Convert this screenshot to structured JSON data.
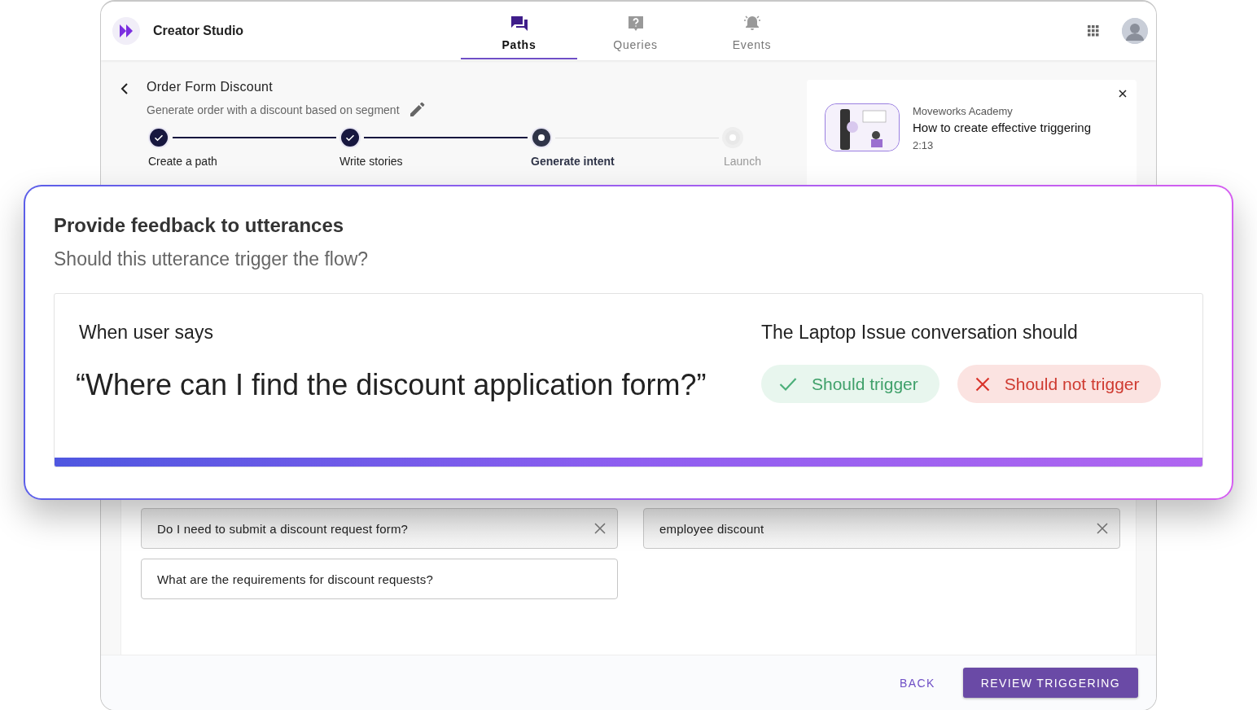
{
  "app": {
    "title": "Creator Studio"
  },
  "tabs": [
    {
      "label": "Paths",
      "selected": true
    },
    {
      "label": "Queries",
      "selected": false
    },
    {
      "label": "Events",
      "selected": false
    }
  ],
  "path": {
    "title": "Order Form Discount",
    "description": "Generate order with a discount based on segment"
  },
  "steps": [
    {
      "label": "Create a path",
      "kind": "done"
    },
    {
      "label": "Write stories",
      "kind": "done"
    },
    {
      "label": "Generate intent",
      "kind": "current"
    },
    {
      "label": "Launch",
      "kind": "pending"
    }
  ],
  "academy": {
    "source": "Moveworks Academy",
    "title": "How to create effective triggering",
    "duration": "2:13"
  },
  "utterances": [
    {
      "text": "Do I need to submit a discount request form?",
      "removable": true
    },
    {
      "text": "employee discount",
      "removable": true
    },
    {
      "text": "What are the requirements for discount requests?",
      "removable": false
    }
  ],
  "footer": {
    "buttons": [
      {
        "label": "BACK",
        "kind": "text"
      },
      {
        "label": "REVIEW TRIGGERING",
        "kind": "primary"
      }
    ]
  },
  "feedback": {
    "title": "Provide feedback to utterances",
    "subtitle": "Should this utterance trigger the flow?",
    "left_label": "When user says",
    "utterance": "“Where can I find the discount application form?”",
    "right_label": "The Laptop Issue conversation should",
    "options": [
      {
        "label": "Should trigger",
        "kind": "positive"
      },
      {
        "label": "Should not trigger",
        "kind": "negative"
      }
    ],
    "progress": {
      "level": 1
    }
  }
}
